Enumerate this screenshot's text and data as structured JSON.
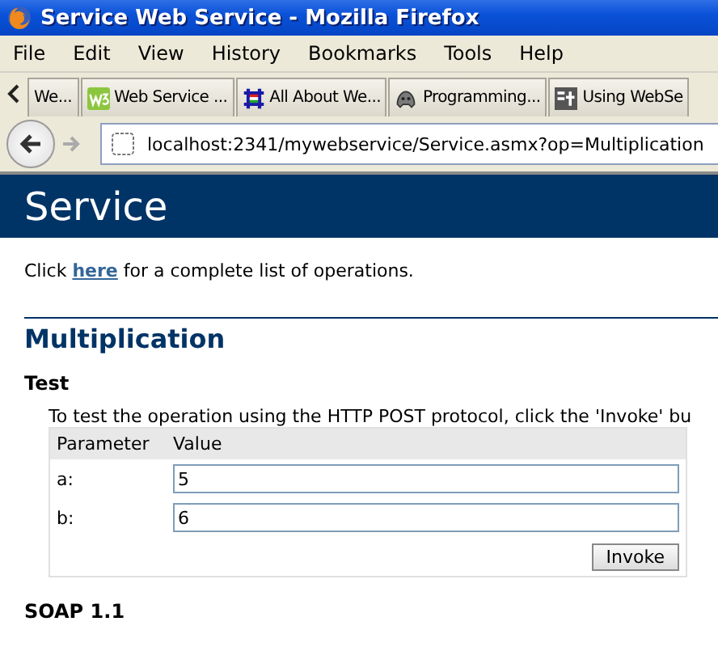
{
  "window": {
    "title": "Service Web Service - Mozilla Firefox"
  },
  "menu": [
    "File",
    "Edit",
    "View",
    "History",
    "Bookmarks",
    "Tools",
    "Help"
  ],
  "tabs": [
    {
      "label": "We...",
      "kind": "plain"
    },
    {
      "label": "Web Service ...",
      "kind": "w3"
    },
    {
      "label": "All About We...",
      "kind": "grid"
    },
    {
      "label": "Programming...",
      "kind": "game"
    },
    {
      "label": "Using WebSe",
      "kind": "square"
    }
  ],
  "address": {
    "value": "localhost:2341/mywebservice/Service.asmx?op=Multiplication"
  },
  "page": {
    "banner": "Service",
    "intro": {
      "before": "Click ",
      "link": "here",
      "after": " for a complete list of operations."
    },
    "operation": "Multiplication",
    "test_heading": "Test",
    "instructions": "To test the operation using the HTTP POST protocol, click the 'Invoke' bu",
    "table": {
      "columns": [
        "Parameter",
        "Value"
      ],
      "rows": [
        {
          "name": "a:",
          "value": "5"
        },
        {
          "name": "b:",
          "value": "6"
        }
      ],
      "button": "Invoke"
    },
    "next_heading": "SOAP 1.1"
  }
}
